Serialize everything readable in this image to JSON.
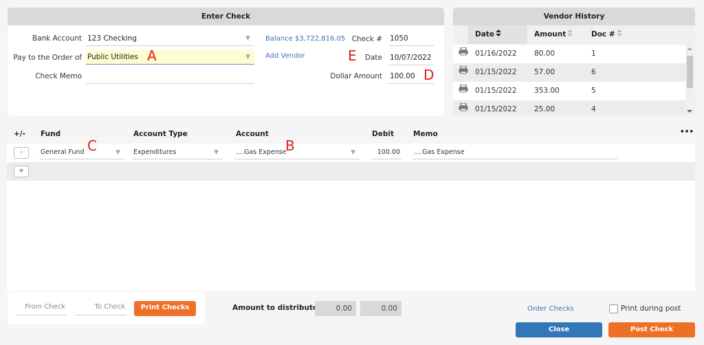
{
  "enter_check": {
    "title": "Enter Check",
    "bank_account": {
      "label": "Bank Account",
      "value": "123 Checking"
    },
    "pay_to": {
      "label": "Pay to the Order of",
      "value": "Public Utilities"
    },
    "check_memo": {
      "label": "Check Memo",
      "value": ""
    },
    "balance_link": "Balance $3,722,816.05",
    "add_vendor_link": "Add Vendor",
    "check_number": {
      "label": "Check #",
      "value": "1050"
    },
    "date": {
      "label": "Date",
      "value": "10/07/2022"
    },
    "dollar_amount": {
      "label": "Dollar Amount",
      "value": "100.00"
    }
  },
  "annotations": {
    "a": "A",
    "b": "B",
    "c": "C",
    "d": "D",
    "e": "E",
    "color": "#e31b1b"
  },
  "vendor_history": {
    "title": "Vendor History",
    "columns": [
      "Date",
      "Amount",
      "Doc #"
    ],
    "rows": [
      {
        "date": "01/16/2022",
        "amount": "80.00",
        "doc": "1"
      },
      {
        "date": "01/15/2022",
        "amount": "57.00",
        "doc": "6"
      },
      {
        "date": "01/15/2022",
        "amount": "353.00",
        "doc": "5"
      },
      {
        "date": "01/15/2022",
        "amount": "25.00",
        "doc": "4"
      }
    ]
  },
  "distribution": {
    "columns": {
      "plus_minus": "+/-",
      "fund": "Fund",
      "account_type": "Account Type",
      "account": "Account",
      "debit": "Debit",
      "memo": "Memo",
      "more": "•••"
    },
    "rows": [
      {
        "remove": "-",
        "fund": "General Fund",
        "account_type": "Expenditures",
        "account": "....Gas Expense",
        "debit": "100.00",
        "memo": "....Gas Expense"
      }
    ],
    "add_label": "+"
  },
  "footer": {
    "from_check_placeholder": "From Check",
    "to_check_placeholder": "To Check",
    "print_checks": "Print Checks",
    "amount_to_distribute_label": "Amount to distribute",
    "amount_to_distribute_1": "0.00",
    "amount_to_distribute_2": "0.00",
    "order_checks": "Order Checks",
    "print_during_post": "Print during post",
    "close": "Close",
    "post_check": "Post Check"
  },
  "colors": {
    "accent_orange": "#ee7027",
    "accent_blue": "#3377b8",
    "link": "#3b6fb5",
    "highlight": "#fdfdd0"
  }
}
